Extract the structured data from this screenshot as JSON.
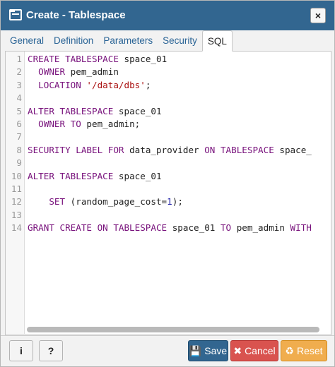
{
  "window": {
    "title": "Create - Tablespace",
    "close_label": "×"
  },
  "tabs": [
    {
      "label": "General"
    },
    {
      "label": "Definition"
    },
    {
      "label": "Parameters"
    },
    {
      "label": "Security"
    },
    {
      "label": "SQL"
    }
  ],
  "active_tab": "SQL",
  "editor": {
    "lines": [
      {
        "num": "1",
        "parts": [
          {
            "t": "kw",
            "v": "CREATE TABLESPACE"
          },
          {
            "t": "txt",
            "v": " space_01"
          }
        ]
      },
      {
        "num": "2",
        "parts": [
          {
            "t": "kw",
            "v": "  OWNER"
          },
          {
            "t": "txt",
            "v": " pem_admin"
          }
        ]
      },
      {
        "num": "3",
        "parts": [
          {
            "t": "kw",
            "v": "  LOCATION"
          },
          {
            "t": "txt",
            "v": " "
          },
          {
            "t": "str",
            "v": "'/data/dbs'"
          },
          {
            "t": "txt",
            "v": ";"
          }
        ]
      },
      {
        "num": "4",
        "parts": []
      },
      {
        "num": "5",
        "parts": [
          {
            "t": "kw",
            "v": "ALTER TABLESPACE"
          },
          {
            "t": "txt",
            "v": " space_01"
          }
        ]
      },
      {
        "num": "6",
        "parts": [
          {
            "t": "kw",
            "v": "  OWNER TO"
          },
          {
            "t": "txt",
            "v": " pem_admin;"
          }
        ]
      },
      {
        "num": "7",
        "parts": []
      },
      {
        "num": "8",
        "parts": [
          {
            "t": "kw",
            "v": "SECURITY LABEL FOR"
          },
          {
            "t": "txt",
            "v": " data_provider "
          },
          {
            "t": "kw",
            "v": "ON TABLESPACE"
          },
          {
            "t": "txt",
            "v": " space_"
          }
        ]
      },
      {
        "num": "9",
        "parts": []
      },
      {
        "num": "10",
        "parts": [
          {
            "t": "kw",
            "v": "ALTER TABLESPACE"
          },
          {
            "t": "txt",
            "v": " space_01"
          }
        ]
      },
      {
        "num": "11",
        "parts": []
      },
      {
        "num": "12",
        "parts": [
          {
            "t": "kw",
            "v": "    SET"
          },
          {
            "t": "txt",
            "v": " (random_page_cost="
          },
          {
            "t": "num",
            "v": "1"
          },
          {
            "t": "txt",
            "v": ");"
          }
        ]
      },
      {
        "num": "13",
        "parts": []
      },
      {
        "num": "14",
        "parts": [
          {
            "t": "kw",
            "v": "GRANT CREATE ON TABLESPACE"
          },
          {
            "t": "txt",
            "v": " space_01 "
          },
          {
            "t": "kw",
            "v": "TO"
          },
          {
            "t": "txt",
            "v": " pem_admin "
          },
          {
            "t": "kw",
            "v": "WITH"
          }
        ]
      }
    ]
  },
  "footer": {
    "info_label": "i",
    "help_label": "?",
    "save_label": "Save",
    "cancel_label": "Cancel",
    "reset_label": "Reset"
  },
  "colors": {
    "titlebar": "#326690",
    "keyword": "#77107b",
    "string": "#a11111",
    "number": "#1a1aa6",
    "save": "#326690",
    "cancel": "#d9534f",
    "reset": "#f0ad4e"
  }
}
